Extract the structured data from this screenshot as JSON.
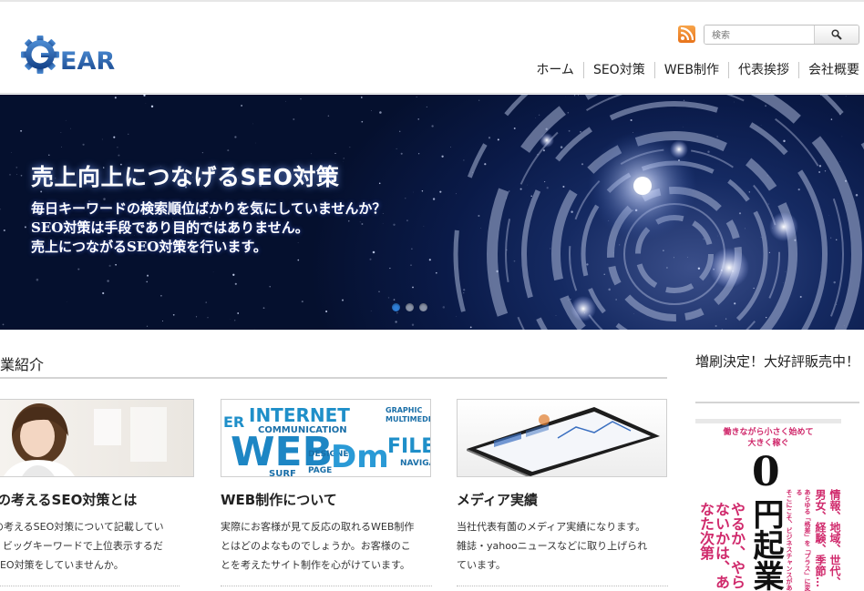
{
  "header": {
    "logo_text": "GEAR",
    "search": {
      "placeholder": "検索"
    },
    "nav": [
      "ホーム",
      "SEO対策",
      "WEB制作",
      "代表挨拶",
      "会社概要"
    ]
  },
  "hero": {
    "title": "売上向上につなげるSEO対策",
    "lines": [
      "毎日キーワードの検索順位ばかりを気にしていませんか？",
      "SEO対策は手段であり目的ではありません。",
      "売上につながるSEO対策を行います。"
    ],
    "slides": 3,
    "active_slide": 1
  },
  "main": {
    "section_title": "業紹介",
    "cards": [
      {
        "title": "社の考えるSEO対策とは",
        "lines": [
          "社の考えるSEO対策について記載してい",
          "す。ビッグキーワードで上位表示するだ",
          "のSEO対策をしていませんか。"
        ]
      },
      {
        "title": "WEB制作について",
        "thumb_words": [
          "INTERNET",
          "COMMUNICATION",
          "WEB",
          "DESIGNER",
          "PAGE",
          "FILE",
          "NAVIGAT",
          "GRAPHIC",
          "MULTIMEDIA",
          "SURF",
          "ER"
        ],
        "lines": [
          "実際にお客様が見て反応の取れるWEB制作",
          "とはどのよなものでしょうか。お客様のこ",
          "とを考えたサイト制作を心がけています。"
        ]
      },
      {
        "title": "メディア実績",
        "lines": [
          "当社代表有薗のメディア実績になります。",
          "雑誌・yahooニュースなどに取り上げられ",
          "ています。"
        ]
      }
    ]
  },
  "sidebar": {
    "title": "増刷決定！大好評販売中！",
    "book": {
      "tagline": [
        "働きながら小さく始めて",
        "大きく稼ぐ"
      ],
      "zero": "0",
      "title_vertical": "円起業",
      "red_vertical": "やるか、やらないかは、あなた次第",
      "side_text": [
        "情報、地域、世代、",
        "男女、経験、季節…",
        "あらゆる「格差」を「プラス」に変える",
        "そこにこそ、ビジネスチャンスがある"
      ]
    }
  },
  "colors": {
    "accent_blue": "#2f7fd8",
    "logo_blue": "#1d5ea8",
    "hero_bg": "#0a1a48",
    "book_red": "#d02a6c"
  },
  "icons": [
    "rss-icon",
    "search-icon",
    "gear-logo-icon"
  ]
}
